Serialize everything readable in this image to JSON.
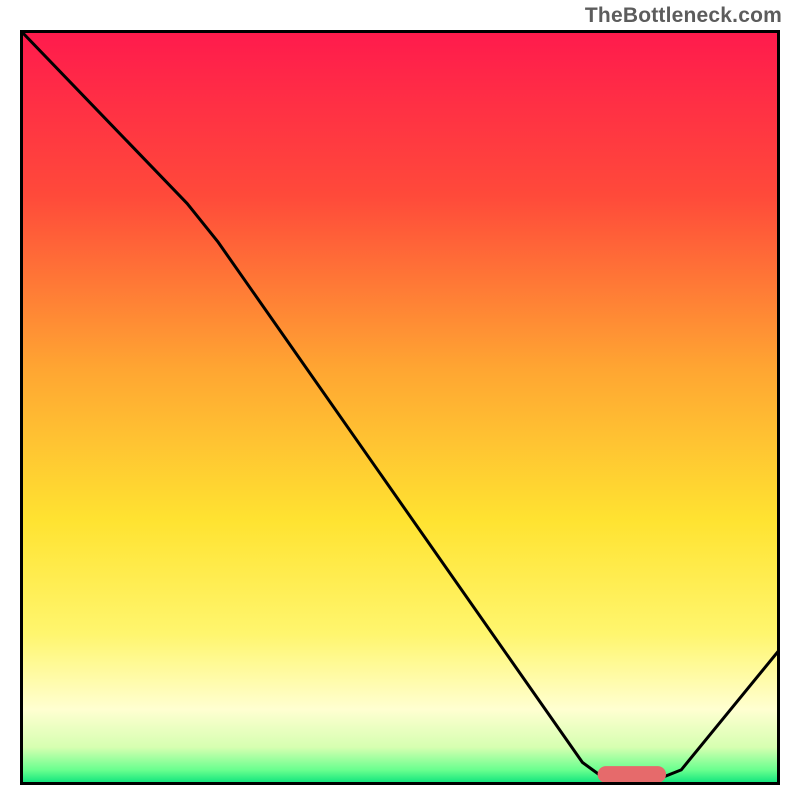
{
  "watermark": "TheBottleneck.com",
  "chart_data": {
    "type": "line",
    "title": "",
    "xlabel": "",
    "ylabel": "",
    "xlim": [
      0,
      100
    ],
    "ylim": [
      0,
      100
    ],
    "gradient_stops": [
      {
        "offset": 0.0,
        "color": "#ff1a4d"
      },
      {
        "offset": 0.22,
        "color": "#ff4a3a"
      },
      {
        "offset": 0.45,
        "color": "#ffa632"
      },
      {
        "offset": 0.65,
        "color": "#ffe331"
      },
      {
        "offset": 0.8,
        "color": "#fff66e"
      },
      {
        "offset": 0.9,
        "color": "#ffffd1"
      },
      {
        "offset": 0.95,
        "color": "#d6ffb1"
      },
      {
        "offset": 0.98,
        "color": "#6aff8f"
      },
      {
        "offset": 1.0,
        "color": "#00e07a"
      }
    ],
    "curve_points": [
      {
        "x": 0,
        "y": 100
      },
      {
        "x": 22,
        "y": 77
      },
      {
        "x": 26,
        "y": 72
      },
      {
        "x": 74,
        "y": 3
      },
      {
        "x": 77,
        "y": 0.8
      },
      {
        "x": 84,
        "y": 0.8
      },
      {
        "x": 87,
        "y": 2
      },
      {
        "x": 100,
        "y": 18
      }
    ],
    "marker": {
      "x_start": 76,
      "x_end": 85,
      "y": 1.4,
      "color": "#e66a6b",
      "thickness": 2.2
    },
    "frame_color": "#000000",
    "curve_color": "#000000"
  }
}
